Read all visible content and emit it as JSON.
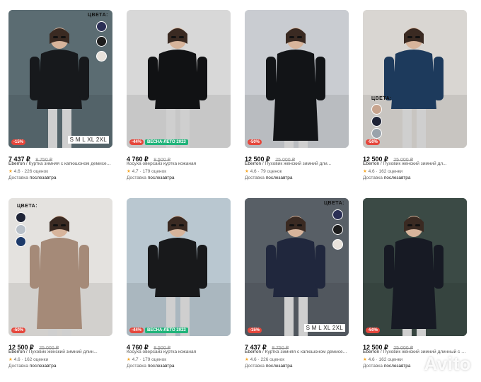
{
  "cards": [
    {
      "price": "7 437 ₽",
      "old_price": "8 750 ₽",
      "brand": "Eberron",
      "title": "Куртка зимняя с капюшоном демисезон",
      "rating": "4.6",
      "reviews": "226 оценок",
      "delivery_label": "Доставка",
      "delivery_value": "послезавтра",
      "discount": "-15%",
      "season": "",
      "sizes": "S M L XL 2XL",
      "colors_label": "ЦВЕТА:",
      "swatches": [
        "#2b2f55",
        "#1d1d1d",
        "#e8e2db"
      ],
      "coat": "#17191c",
      "bg": "#5b6c72"
    },
    {
      "price": "4 760 ₽",
      "old_price": "8 500 ₽",
      "brand": "",
      "title": "Косуха оверсайз куртка кожаная",
      "rating": "4.7",
      "reviews": "179 оценок",
      "delivery_label": "Доставка",
      "delivery_value": "послезавтра",
      "discount": "-44%",
      "season": "ВЕСНА-ЛЕТО 2023",
      "sizes": "",
      "colors_label": "",
      "swatches": [],
      "coat": "#111214",
      "bg": "#d8d8d8"
    },
    {
      "price": "12 500 ₽",
      "old_price": "25 000 ₽",
      "brand": "Eberron",
      "title": "Пуховик женский зимний дли...",
      "rating": "4.6",
      "reviews": "79 оценок",
      "delivery_label": "Доставка",
      "delivery_value": "послезавтра",
      "discount": "-50%",
      "season": "",
      "sizes": "",
      "colors_label": "",
      "swatches": [],
      "coat": "#121417",
      "bg": "#c9ccd1"
    },
    {
      "price": "12 500 ₽",
      "old_price": "25 000 ₽",
      "brand": "Eberron",
      "title": "Пуховик женский зимний дл...",
      "rating": "4.6",
      "reviews": "162 оценки",
      "delivery_label": "Доставка",
      "delivery_value": "послезавтра",
      "discount": "-50%",
      "season": "",
      "sizes": "",
      "colors_label": "ЦВЕТА:",
      "swatches": [
        "#c7a48e",
        "#1f2437",
        "#9aa3ab"
      ],
      "coat": "#1d3a5c",
      "bg": "#d9d6d2"
    },
    {
      "price": "12 500 ₽",
      "old_price": "25 000 ₽",
      "brand": "Eberron",
      "title": "Пуховик женский зимний длин...",
      "rating": "4.6",
      "reviews": "162 оценки",
      "delivery_label": "Доставка",
      "delivery_value": "послезавтра",
      "discount": "-50%",
      "season": "",
      "sizes": "",
      "colors_label": "ЦВЕТА:",
      "swatches": [
        "#1f2437",
        "#b8c0c9",
        "#1d3a6a"
      ],
      "coat": "#a58a78",
      "bg": "#e4e2df"
    },
    {
      "price": "4 760 ₽",
      "old_price": "8 500 ₽",
      "brand": "",
      "title": "Косуха оверсайз куртка кожаная",
      "rating": "4.7",
      "reviews": "179 оценок",
      "delivery_label": "Доставка",
      "delivery_value": "послезавтра",
      "discount": "-44%",
      "season": "ВЕСНА-ЛЕТО 2023",
      "sizes": "",
      "colors_label": "",
      "swatches": [],
      "coat": "#18191b",
      "bg": "#b9c7d0"
    },
    {
      "price": "7 437 ₽",
      "old_price": "8 750 ₽",
      "brand": "Eberron",
      "title": "Куртка зимняя с капюшоном демисезон",
      "rating": "4.6",
      "reviews": "226 оценок",
      "delivery_label": "Доставка",
      "delivery_value": "послезавтра",
      "discount": "-15%",
      "season": "",
      "sizes": "S M L XL 2XL",
      "colors_label": "ЦВЕТА:",
      "swatches": [
        "#2b2f55",
        "#1d1d1d",
        "#e8e2db"
      ],
      "coat": "#20273d",
      "bg": "#585f66"
    },
    {
      "price": "12 500 ₽",
      "old_price": "25 000 ₽",
      "brand": "Eberron",
      "title": "Пуховик женский зимний длинный с п...",
      "rating": "4.6",
      "reviews": "162 оценки",
      "delivery_label": "Доставка",
      "delivery_value": "послезавтра",
      "discount": "-50%",
      "season": "",
      "sizes": "",
      "colors_label": "",
      "swatches": [],
      "coat": "#171a24",
      "bg": "#3b4a45"
    }
  ],
  "watermark": "Avito"
}
